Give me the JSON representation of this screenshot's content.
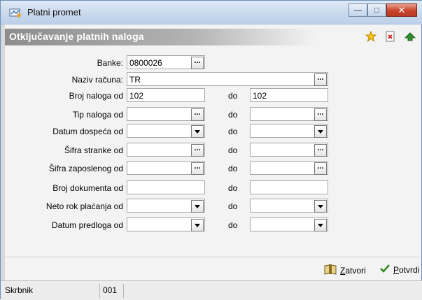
{
  "window": {
    "title": "Platni promet"
  },
  "header": {
    "title": "Otključavanje platnih naloga",
    "icons": [
      "star-icon",
      "close-document-icon",
      "green-arrow-icon"
    ]
  },
  "form": {
    "banke": {
      "label": "Banke:",
      "value": "0800026"
    },
    "naziv_racuna": {
      "label": "Naziv računa:",
      "value": "TR"
    },
    "broj_naloga": {
      "label": "Broj naloga od",
      "from": "102",
      "to_label": "do",
      "to": "102"
    },
    "tip_naloga": {
      "label": "Tip naloga od",
      "to_label": "do"
    },
    "datum_dospeca": {
      "label": "Datum dospeća od",
      "to_label": "do"
    },
    "sifra_stranke": {
      "label": "Šifra stranke od",
      "to_label": "do"
    },
    "sifra_zaposlenog": {
      "label": "Šifra zaposlenog od",
      "to_label": "do"
    },
    "broj_dokumenta": {
      "label": "Broj dokumenta od",
      "to_label": "do"
    },
    "neto_rok": {
      "label": "Neto rok plaćanja od",
      "to_label": "do"
    },
    "datum_predloga": {
      "label": "Datum predloga od",
      "to_label": "do"
    }
  },
  "footer": {
    "close_label_prefix": "Z",
    "close_label_rest": "atvori",
    "confirm_label_prefix": "P",
    "confirm_label_rest": "otvrdi"
  },
  "status": {
    "user": "Skrbnik",
    "code": "001"
  },
  "colors": {
    "header_gradient_start": "#8d8d8d",
    "close_button": "#c8412a",
    "confirm_check": "#2c8a1a"
  }
}
